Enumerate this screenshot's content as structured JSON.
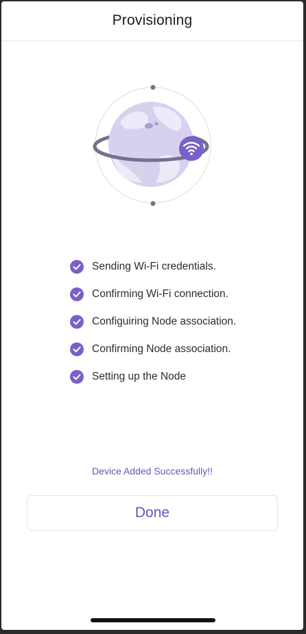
{
  "header": {
    "title": "Provisioning"
  },
  "illustration": {
    "icon": "globe-orbit-wifi-icon",
    "accent": "#7b5fc9",
    "globe_color": "#d8d1ee",
    "ring_color": "#76708f"
  },
  "steps": [
    {
      "label": "Sending Wi-Fi credentials.",
      "status": "done"
    },
    {
      "label": "Confirming Wi-Fi connection.",
      "status": "done"
    },
    {
      "label": "Configuiring Node association.",
      "status": "done"
    },
    {
      "label": "Confirming Node association.",
      "status": "done"
    },
    {
      "label": "Setting up the Node",
      "status": "done"
    }
  ],
  "status_message": "Device Added Successfully!!",
  "done_button": {
    "label": "Done"
  },
  "colors": {
    "accent": "#6a52b5",
    "check": "#7b5fc9"
  }
}
